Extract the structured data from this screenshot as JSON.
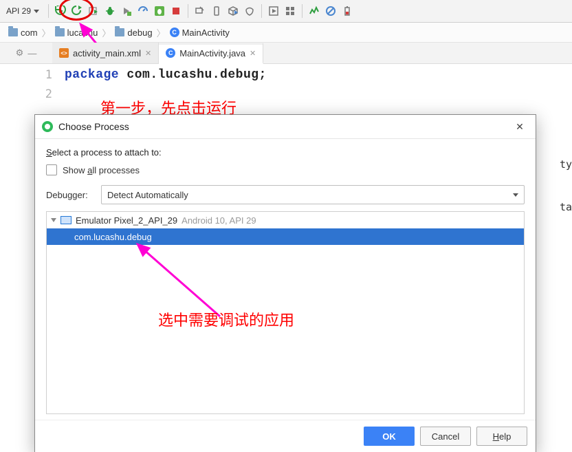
{
  "toolbar": {
    "api_selector": "API 29"
  },
  "breadcrumbs": {
    "b1": "com",
    "b2": "lucashu",
    "b3": "debug",
    "b4": "MainActivity",
    "class_letter": "C"
  },
  "tabs": {
    "t0_label": "activity_main.xml",
    "t0_icon_txt": "<>",
    "t1_label": "MainActivity.java",
    "t1_icon_txt": "C",
    "close_glyph": "✕"
  },
  "editor": {
    "lineno1": "1",
    "lineno2": "2",
    "kw_package": "package",
    "pkg_text": " com.lucashu.debug;"
  },
  "annotation1": "第一步，先点击运行",
  "annotation2": "选中需要调试的应用",
  "dialog": {
    "title": "Choose Process",
    "close_glyph": "✕",
    "prompt_pre": "S",
    "prompt_main": "elect a process to attach to:",
    "show_all_pre": "Show ",
    "show_all_u": "a",
    "show_all_post": "ll processes",
    "debugger_label": "Debugger:",
    "debugger_value": "Detect Automatically",
    "device_name": "Emulator Pixel_2_API_29",
    "device_meta": " Android 10, API 29",
    "process": "com.lucashu.debug",
    "btn_ok": "OK",
    "btn_cancel": "Cancel",
    "btn_help_u": "H",
    "btn_help_rest": "elp"
  },
  "side_code": {
    "l1": "ty",
    "l2": "ta"
  }
}
